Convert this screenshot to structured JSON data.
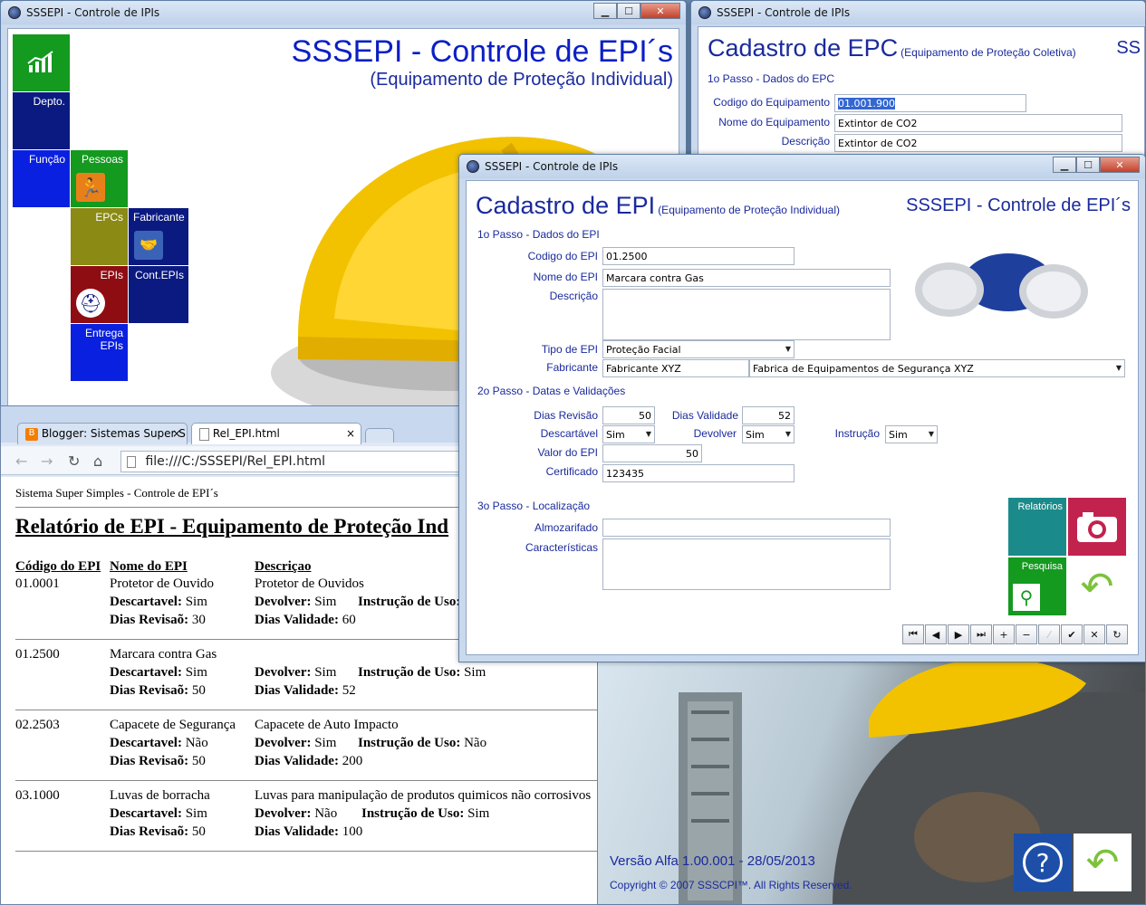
{
  "main_window": {
    "title": "SSSEPI - Controle de IPIs",
    "heading": "SSSEPI - Controle de EPI´s",
    "subheading": "(Equipamento de Proteção Individual)",
    "tiles": {
      "depto": "Depto.",
      "funcao": "Função",
      "pessoas": "Pessoas",
      "epcs": "EPCs",
      "fabricante": "Fabricante",
      "epis": "EPIs",
      "cont_epis": "Cont.EPIs",
      "entrega_line1": "Entrega",
      "entrega_line2": "EPIs"
    }
  },
  "epc_window": {
    "title": "SSSEPI - Controle de IPIs",
    "heading": "Cadastro de EPC",
    "heading_sub": "(Equipamento de Proteção Coletiva)",
    "brand_fragment": "SS",
    "step1": "1o Passo - Dados do EPC",
    "labels": {
      "codigo": "Codigo do Equipamento",
      "nome": "Nome do Equipamento",
      "descricao": "Descrição"
    },
    "values": {
      "codigo": "01.001.900",
      "nome": "Extintor de CO2",
      "descricao": "Extintor de CO2"
    }
  },
  "browser": {
    "tabs": [
      {
        "label": "Blogger: Sistemas Super S"
      },
      {
        "label": "Rel_EPI.html"
      }
    ],
    "url": "file:///C:/SSSEPI/Rel_EPI.html",
    "report": {
      "top_text": "Sistema Super Simples - Controle de EPI´s",
      "title": "Relatório de EPI - Equipamento de Proteção Ind",
      "col_codigo": "Código do EPI",
      "col_nome": "Nome do EPI",
      "col_descricao": "Descriçao",
      "lbl_descartavel": "Descartavel:",
      "lbl_devolver": "Devolver:",
      "lbl_instrucao": "Instrução de Uso:",
      "lbl_revisao": "Dias Revisaõ:",
      "lbl_validade": "Dias Validade:",
      "rows": [
        {
          "codigo": "01.0001",
          "nome": "Protetor de Ouvido",
          "descricao": "Protetor de Ouvidos",
          "descartavel": "Sim",
          "devolver": "Sim",
          "instrucao": "",
          "revisao": "30",
          "validade": "60"
        },
        {
          "codigo": "01.2500",
          "nome": "Marcara contra Gas",
          "descricao": "",
          "descartavel": "Sim",
          "devolver": "Sim",
          "instrucao": "Sim",
          "revisao": "50",
          "validade": "52"
        },
        {
          "codigo": "02.2503",
          "nome": "Capacete de Segurança",
          "descricao": "Capacete de Auto Impacto",
          "descartavel": "Não",
          "devolver": "Sim",
          "instrucao": "Não",
          "revisao": "50",
          "validade": "200"
        },
        {
          "codigo": "03.1000",
          "nome": "Luvas de borracha",
          "descricao": "Luvas para manipulação de produtos quimicos não corrosivos",
          "descartavel": "Sim",
          "devolver": "Não",
          "instrucao": "Sim",
          "revisao": "50",
          "validade": "100"
        }
      ]
    }
  },
  "epi_window": {
    "title": "SSSEPI - Controle de IPIs",
    "heading": "Cadastro de EPI",
    "heading_sub": "(Equipamento de Proteção Individual)",
    "brand": "SSSEPI - Controle de EPI´s",
    "step1": "1o Passo - Dados do EPI",
    "step2": "2o Passo - Datas e Validações",
    "step3": "3o Passo - Localização",
    "labels": {
      "codigo": "Codigo do EPI",
      "nome": "Nome do EPI",
      "descricao": "Descrição",
      "tipo": "Tipo de EPI",
      "fabricante": "Fabricante",
      "dias_revisao": "Dias Revisão",
      "dias_validade": "Dias Validade",
      "descartavel": "Descartável",
      "devolver": "Devolver",
      "instrucao": "Instrução",
      "valor": "Valor do EPI",
      "certificado": "Certificado",
      "almozarifado": "Almozarifado",
      "caracteristicas": "Características"
    },
    "values": {
      "codigo": "01.2500",
      "nome": "Marcara contra Gas",
      "descricao": "",
      "tipo": "Proteção Facial",
      "fabricante_code": "Fabricante XYZ",
      "fabricante_name": "Fabrica de Equipamentos de Segurança XYZ",
      "dias_revisao": "50",
      "dias_validade": "52",
      "descartavel": "Sim",
      "devolver": "Sim",
      "instrucao": "Sim",
      "valor": "50",
      "certificado": "123435",
      "almozarifado": "",
      "caracteristicas": ""
    },
    "buttons": {
      "relatorios": "Relatórios",
      "pesquisa": "Pesquisa"
    }
  },
  "splash": {
    "version": "Versão Alfa 1.00.001 - 28/05/2013",
    "copyright": "Copyright © 2007 SSSCPI™. All Rights Reserved."
  }
}
